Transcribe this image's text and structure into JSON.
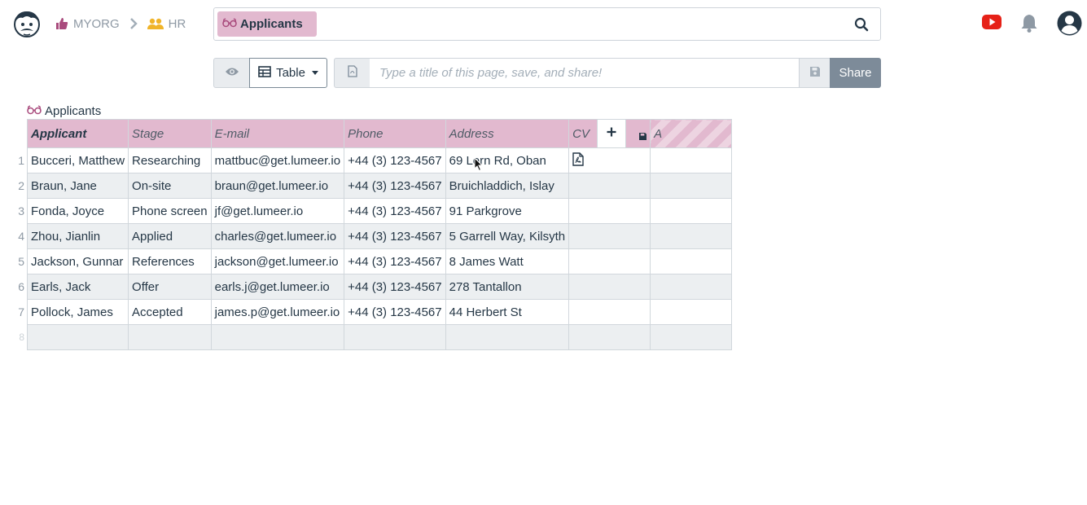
{
  "header": {
    "breadcrumb": [
      {
        "label": "MYORG",
        "icon": "thumbs-up-icon"
      },
      {
        "label": "HR",
        "icon": "users-icon"
      }
    ],
    "search": {
      "chip_label": "Applicants",
      "chip_icon": "glasses-icon"
    }
  },
  "toolbar": {
    "view_label": "Table",
    "title_placeholder": "Type a title of this page, save, and share!",
    "share_label": "Share"
  },
  "table": {
    "title": "Applicants",
    "columns": [
      "Applicant",
      "Stage",
      "E-mail",
      "Phone",
      "Address",
      "CV",
      "A"
    ],
    "rows": [
      {
        "num": "1",
        "cells": [
          "Bucceri, Matthew",
          "Researching",
          "mattbuc@get.lumeer.io",
          "+44 (3) 123-4567",
          "69 Lorn Rd, Oban",
          "",
          ""
        ]
      },
      {
        "num": "2",
        "cells": [
          "Braun, Jane",
          "On-site",
          "braun@get.lumeer.io",
          "+44 (3) 123-4567",
          "Bruichladdich, Islay",
          "",
          ""
        ]
      },
      {
        "num": "3",
        "cells": [
          "Fonda, Joyce",
          "Phone screen",
          "jf@get.lumeer.io",
          "+44 (3) 123-4567",
          "91 Parkgrove",
          "",
          ""
        ]
      },
      {
        "num": "4",
        "cells": [
          "Zhou, Jianlin",
          "Applied",
          "charles@get.lumeer.io",
          "+44 (3) 123-4567",
          "5 Garrell Way, Kilsyth",
          "",
          ""
        ]
      },
      {
        "num": "5",
        "cells": [
          "Jackson, Gunnar",
          "References",
          "jackson@get.lumeer.io",
          "+44 (3) 123-4567",
          "8 James Watt",
          "",
          ""
        ]
      },
      {
        "num": "6",
        "cells": [
          "Earls, Jack",
          "Offer",
          "earls.j@get.lumeer.io",
          "+44 (3) 123-4567",
          "278 Tantallon",
          "",
          ""
        ]
      },
      {
        "num": "7",
        "cells": [
          "Pollock, James",
          "Accepted",
          "james.p@get.lumeer.io",
          "+44 (3) 123-4567",
          "44 Herbert St",
          "",
          ""
        ]
      },
      {
        "num": "8",
        "cells": [
          "",
          "",
          "",
          "",
          "",
          "",
          ""
        ]
      }
    ]
  },
  "colors": {
    "accent": "#e2b9cf",
    "share": "#7d8b99",
    "youtube": "#e62117",
    "brand_thumb": "#a94b7d",
    "users": "#f0b429"
  }
}
